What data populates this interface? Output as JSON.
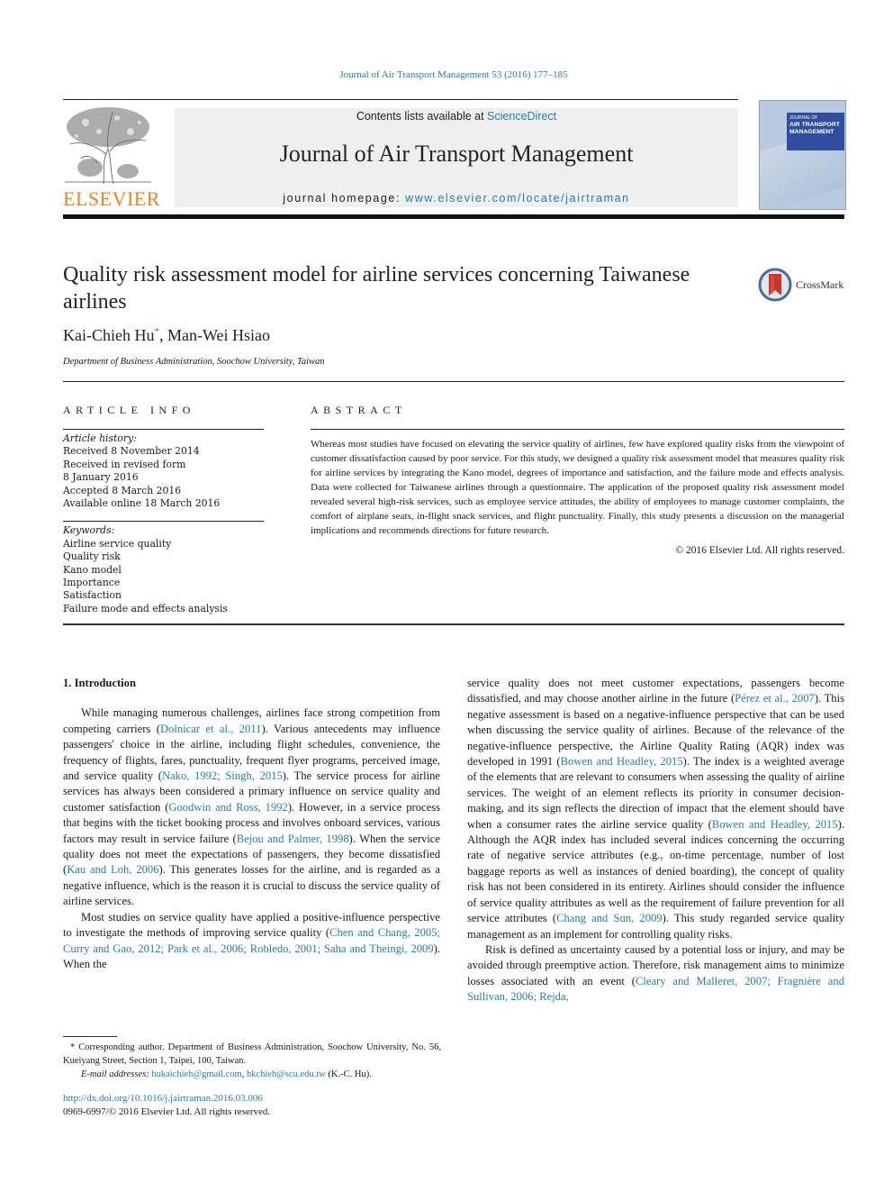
{
  "citation": "Journal of Air Transport Management 53 (2016) 177–185",
  "header": {
    "publisher": "ELSEVIER",
    "contents_prefix": "Contents lists available at ",
    "contents_link": "ScienceDirect",
    "journal_name": "Journal of Air Transport Management",
    "homepage_prefix": "journal homepage: ",
    "homepage_link": "www.elsevier.com/locate/jairtraman",
    "cover_title_small": "JOURNAL OF",
    "cover_title_line1": "AIR TRANSPORT",
    "cover_title_line2": "MANAGEMENT"
  },
  "colors": {
    "link": "#1f7fb0",
    "elsevier_orange": "#f07f22",
    "header_box": "#efefef"
  },
  "article": {
    "title": "Quality risk assessment model for airline services concerning Taiwanese airlines",
    "crossmark_label": "CrossMark",
    "authors": [
      {
        "name": "Kai-Chieh Hu",
        "mark": "*"
      },
      {
        "name": "Man-Wei Hsiao",
        "mark": ""
      }
    ],
    "author_separator": ", ",
    "affiliation": "Department of Business Administration, Soochow University, Taiwan"
  },
  "article_info": {
    "heading": "ARTICLE INFO",
    "history_label": "Article history:",
    "history": [
      "Received 8 November 2014",
      "Received in revised form",
      "8 January 2016",
      "Accepted 8 March 2016",
      "Available online 18 March 2016"
    ],
    "keywords_label": "Keywords:",
    "keywords": [
      "Airline service quality",
      "Quality risk",
      "Kano model",
      "Importance",
      "Satisfaction",
      "Failure mode and effects analysis"
    ]
  },
  "abstract": {
    "heading": "ABSTRACT",
    "text": "Whereas most studies have focused on elevating the service quality of airlines, few have explored quality risks from the viewpoint of customer dissatisfaction caused by poor service. For this study, we designed a quality risk assessment model that measures quality risk for airline services by integrating the Kano model, degrees of importance and satisfaction, and the failure mode and effects analysis. Data were collected for Taiwanese airlines through a questionnaire. The application of the proposed quality risk assessment model revealed several high-risk services, such as employee service attitudes, the ability of employees to manage customer complaints, the comfort of airplane seats, in-flight snack services, and flight punctuality. Finally, this study presents a discussion on the managerial implications and recommends directions for future research.",
    "copyright": "© 2016 Elsevier Ltd. All rights reserved."
  },
  "body": {
    "section_heading": "1.  Introduction",
    "left_paragraphs": [
      [
        {
          "t": "While managing numerous challenges, airlines face strong competition from competing carriers ("
        },
        {
          "l": "Dolnicar et al., 2011"
        },
        {
          "t": "). Various antecedents may influence passengers' choice in the airline, including flight schedules, convenience, the frequency of flights, fares, punctuality, frequent flyer programs, perceived image, and service quality ("
        },
        {
          "l": "Nako, 1992; Singh, 2015"
        },
        {
          "t": "). The service process for airline services has always been considered a primary influence on service quality and customer satisfaction ("
        },
        {
          "l": "Goodwin and Ross, 1992"
        },
        {
          "t": "). However, in a service process that begins with the ticket booking process and involves onboard services, various factors may result in service failure ("
        },
        {
          "l": "Bejou and Palmer, 1998"
        },
        {
          "t": "). When the service quality does not meet the expectations of passengers, they become dissatisfied ("
        },
        {
          "l": "Kau and Loh, 2006"
        },
        {
          "t": "). This generates losses for the airline, and is regarded as a negative influence, which is the reason it is crucial to discuss the service quality of airline services."
        }
      ],
      [
        {
          "t": "Most studies on service quality have applied a positive-influence perspective to investigate the methods of improving service quality ("
        },
        {
          "l": "Chen and Chang, 2005; Curry and Gao, 2012; Park et al., 2006; Robledo, 2001; Saha and Theingi, 2009"
        },
        {
          "t": "). When the"
        }
      ]
    ],
    "right_paragraphs": [
      [
        {
          "t": "service quality does not meet customer expectations, passengers become dissatisfied, and may choose another airline in the future ("
        },
        {
          "l": "Pérez et al., 2007"
        },
        {
          "t": "). This negative assessment is based on a negative-influence perspective that can be used when discussing the service quality of airlines. Because of the relevance of the negative-influence perspective, the Airline Quality Rating (AQR) index was developed in 1991 ("
        },
        {
          "l": "Bowen and Headley, 2015"
        },
        {
          "t": "). The index is a weighted average of the elements that are relevant to consumers when assessing the quality of airline services. The weight of an element reflects its priority in consumer decision-making, and its sign reflects the direction of impact that the element should have when a consumer rates the airline service quality ("
        },
        {
          "l": "Bowen and Headley, 2015"
        },
        {
          "t": "). Although the AQR index has included several indices concerning the occurring rate of negative service attributes (e.g., on-time percentage, number of lost baggage reports as well as instances of denied boarding), the concept of quality risk has not been considered in its entirety. Airlines should consider the influence of service quality attributes as well as the requirement of failure prevention for all service attributes ("
        },
        {
          "l": "Chang and Sun, 2009"
        },
        {
          "t": "). This study regarded service quality management as an implement for controlling quality risks."
        }
      ],
      [
        {
          "t": "Risk is defined as uncertainty caused by a potential loss or injury, and may be avoided through preemptive action. Therefore, risk management aims to minimize losses associated with an event ("
        },
        {
          "l": "Cleary and Malleret, 2007; Fragnière and Sullivan, 2006; Rejda,"
        }
      ]
    ]
  },
  "footnote": {
    "mark": "*",
    "text": " Corresponding author. Department of Business Administration, Soochow University, No. 56, Kueiyang Street, Section 1, Taipei, 100, Taiwan.",
    "email_label": "E-mail addresses: ",
    "emails": [
      "hukaichieh@gmail.com",
      "hkchieh@scu.edu.tw"
    ],
    "email_sep": ", ",
    "email_suffix": " (K.-C. Hu)."
  },
  "doi": {
    "link": "http://dx.doi.org/10.1016/j.jairtraman.2016.03.006",
    "issn": "0969-6997/© 2016 Elsevier Ltd. All rights reserved."
  }
}
